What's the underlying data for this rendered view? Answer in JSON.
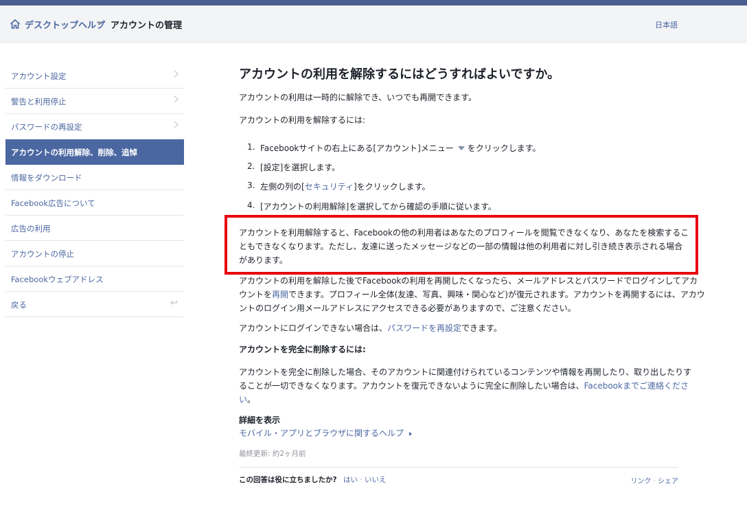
{
  "header": {
    "home_icon": "home-icon",
    "breadcrumb_1": "デスクトップヘルプ",
    "breadcrumb_sep": "▶",
    "breadcrumb_2": "アカウントの管理",
    "language": "日本語"
  },
  "sidebar": {
    "items": [
      {
        "label": "アカウント設定"
      },
      {
        "label": "警告と利用停止"
      },
      {
        "label": "パスワードの再設定"
      },
      {
        "label": "アカウントの利用解除、削除、追悼"
      },
      {
        "label": "情報をダウンロード"
      },
      {
        "label": "Facebook広告について"
      },
      {
        "label": "広告の利用"
      },
      {
        "label": "アカウントの停止"
      },
      {
        "label": "Facebookウェブアドレス"
      },
      {
        "label": "戻る"
      }
    ]
  },
  "main": {
    "title": "アカウントの利用を解除するにはどうすればよいですか。",
    "p1": "アカウントの利用は一時的に解除でき、いつでも再開できます。",
    "p2": "アカウントの利用を解除するには:",
    "steps": [
      {
        "num": "1.",
        "pre": "Facebookサイトの右上にある[アカウント]メニュー",
        "post": "をクリックします。"
      },
      {
        "num": "2.",
        "text": "[設定]を選択します。"
      },
      {
        "num": "3.",
        "pre": "左側の列の[",
        "link": "セキュリティ",
        "post": "]をクリックします。"
      },
      {
        "num": "4.",
        "text": "[アカウントの利用解除]を選択してから確認の手順に従います。"
      }
    ],
    "highlight": {
      "line1": "アカウントを利用解除すると、Facebookの他の利用者はあなたのプロフィールを閲覧できなくなり、あなたを検索するこ",
      "line2": "ともできなくなります。ただし、友達に送ったメッセージなどの一部の情報は他の利用者に対し引き続き表示される場合",
      "line3": "があります。"
    },
    "p3": {
      "line1": "アカウントの利用を解除した後でFacebookの利用を再開したくなったら、メールアドレスとパスワードでログインしてアカ",
      "line2_pre": "ウントを",
      "line2_link": "再開",
      "line2_post": "できます。プロフィール全体(友達、写真、興味・関心など)が復元されます。アカウントを再開するには、アカウ",
      "line3": "ントのログイン用メールアドレスにアクセスできる必要がありますので、ご注意ください。"
    },
    "p4": {
      "pre": "アカウントにログインできない場合は、",
      "link": "パスワードを再設定",
      "post": "できます。"
    },
    "delete_heading": "アカウントを完全に削除するには:",
    "p5": {
      "line1": "アカウントを完全に削除した場合、そのアカウントに関連付けられているコンテンツや情報を再開したり、取り出したりす",
      "line2_pre": "ることが一切できなくなります。アカウントを復元できないように完全に削除したい場合は、",
      "line2_link": "Facebookまでご連絡くださ",
      "line3_link": "い",
      "line3_post": "。"
    },
    "details_heading": "詳細を表示",
    "details_link": "モバイル・アプリとブラウザに関するヘルプ",
    "last_updated": "最終更新: 約2ヶ月前"
  },
  "footer": {
    "question": "この回答は役に立ちましたか?",
    "yes": "はい",
    "sep": "·",
    "no": "いいえ",
    "link": "リンク",
    "share": "シェア"
  }
}
